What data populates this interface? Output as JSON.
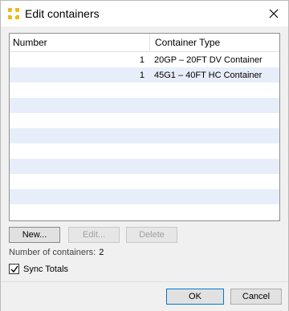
{
  "window": {
    "title": "Edit containers",
    "close_icon": "close-icon",
    "app_icon": "app-icon"
  },
  "table": {
    "headers": [
      "Number",
      "Container Type"
    ],
    "rows": [
      {
        "number": "1",
        "type": "20GP – 20FT DV Container"
      },
      {
        "number": "1",
        "type": "45G1 – 40FT HC Container"
      }
    ]
  },
  "buttons": {
    "new": "New...",
    "edit": "Edit...",
    "delete": "Delete",
    "ok": "OK",
    "cancel": "Cancel"
  },
  "summary": {
    "label": "Number of containers:",
    "value": "2"
  },
  "sync": {
    "label": "Sync Totals",
    "checked": true
  },
  "colors": {
    "row_alt": "#e8eef9",
    "accent": "#0078d7",
    "icon": "#f2b81c"
  }
}
